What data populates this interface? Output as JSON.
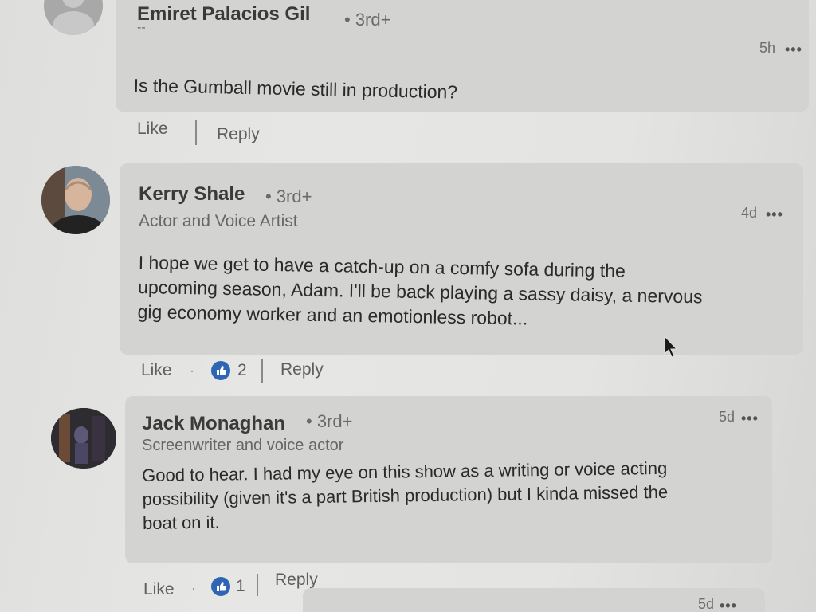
{
  "comments": [
    {
      "name": "Emiret Palacios Gil",
      "degree": "• 3rd+",
      "headline": "--",
      "time": "5h",
      "more": "•••",
      "body": "Is the Gumball movie still in production?",
      "actions": {
        "like": "Like",
        "reply": "Reply"
      }
    },
    {
      "name": "Kerry Shale",
      "degree": "• 3rd+",
      "headline": "Actor and Voice Artist",
      "time": "4d",
      "more": "•••",
      "body_lines": [
        "I hope we get to have a catch-up on a comfy sofa during the",
        "upcoming season, Adam. I'll be back playing a sassy daisy, a nervous",
        "gig economy worker and an emotionless robot..."
      ],
      "actions": {
        "like": "Like",
        "dot": "·",
        "reaction_count": "2",
        "reply": "Reply"
      }
    },
    {
      "name": "Jack Monaghan",
      "degree": "• 3rd+",
      "headline": "Screenwriter and voice actor",
      "time": "5d",
      "more": "•••",
      "body_lines": [
        "Good to hear. I had my eye on this show as a writing or voice acting",
        "possibility (given it's a part British production) but I kinda missed the",
        "boat on it."
      ],
      "actions": {
        "like": "Like",
        "dot": "·",
        "reaction_count": "1",
        "reply": "Reply"
      }
    },
    {
      "time": "5d",
      "more": "•••"
    }
  ],
  "colors": {
    "like_badge": "#2f66b3",
    "bubble": "#d3d3d1"
  },
  "icons": {
    "like_badge": "thumbs-up-icon",
    "cursor": "mouse-pointer-icon"
  }
}
